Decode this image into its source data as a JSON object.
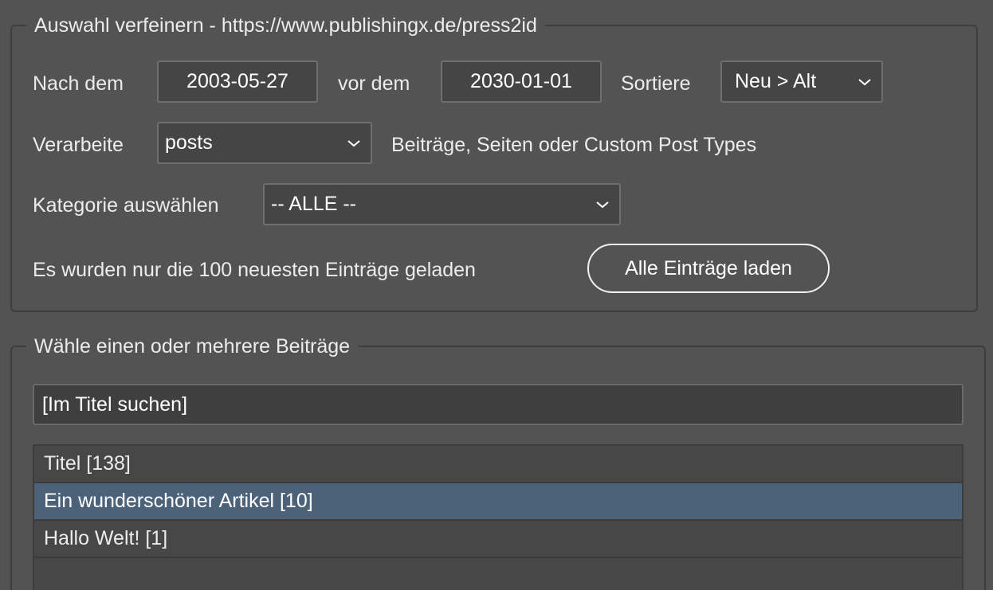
{
  "refine": {
    "legend": "Auswahl verfeinern - https://www.publishingx.de/press2id",
    "after_label": "Nach dem",
    "after_value": "2003-05-27",
    "before_label": "vor dem",
    "before_value": "2030-01-01",
    "sort_label": "Sortiere",
    "sort_value": "Neu > Alt",
    "process_label": "Verarbeite",
    "process_value": "posts",
    "process_hint": "Beiträge, Seiten oder Custom Post Types",
    "category_label": "Kategorie auswählen",
    "category_value": "-- ALLE --",
    "loaded_notice": "Es wurden nur die 100 neuesten Einträge geladen",
    "load_all_button": "Alle Einträge laden"
  },
  "select": {
    "legend": "Wähle einen oder mehrere Beiträge",
    "search_value": "[Im Titel suchen]",
    "items": [
      {
        "label": "Titel [138]",
        "selected": false
      },
      {
        "label": "Ein wunderschöner Artikel [10]",
        "selected": true
      },
      {
        "label": "Hallo Welt! [1]",
        "selected": false
      },
      {
        "label": "",
        "selected": false
      }
    ]
  },
  "colors": {
    "background": "#535353",
    "selection": "#4c6279"
  }
}
